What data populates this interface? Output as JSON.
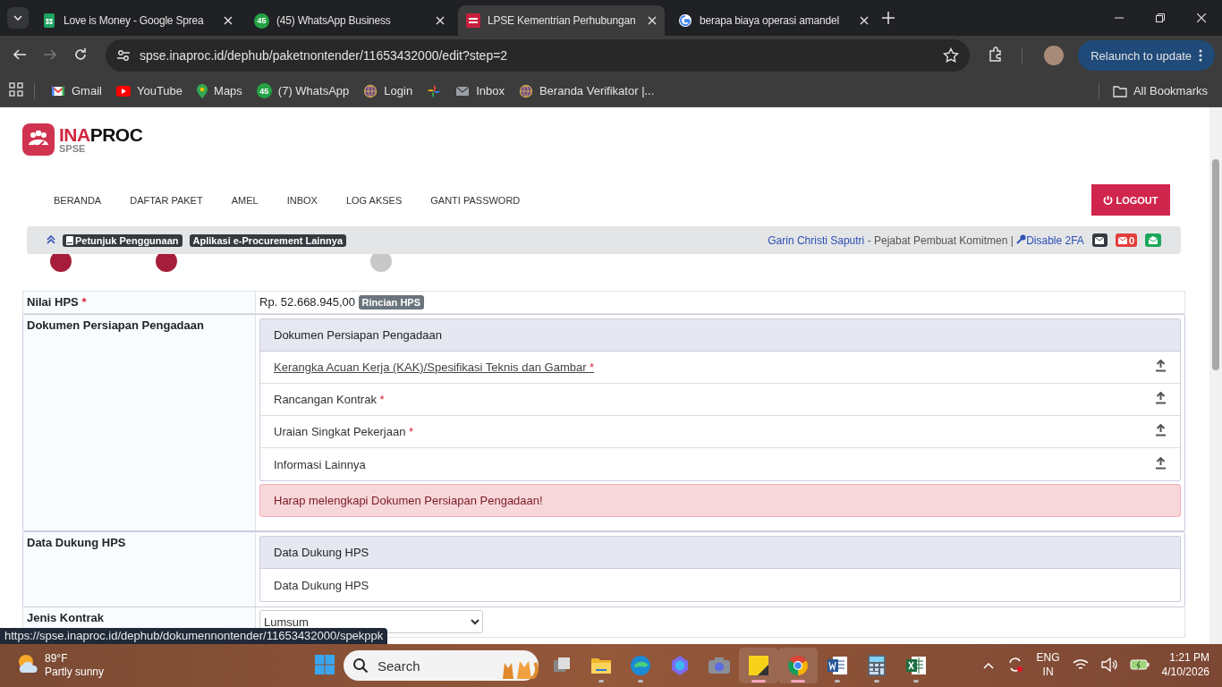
{
  "browser": {
    "tabs": [
      {
        "kind": "sheets",
        "title": "Love is Money - Google Sprea",
        "selected": false
      },
      {
        "kind": "whatsapp",
        "badge": "45",
        "title": "(45) WhatsApp Business",
        "selected": false
      },
      {
        "kind": "inaproc",
        "title": "LPSE Kementrian Perhubungan",
        "selected": true
      },
      {
        "kind": "google",
        "title": "berapa biaya operasi amandel",
        "selected": false
      }
    ],
    "address": "spse.inaproc.id/dephub/paketnontender/11653432000/edit?step=2",
    "relaunch": "Relaunch to update",
    "bookmarks": [
      {
        "kind": "gmail",
        "label": "Gmail"
      },
      {
        "kind": "youtube",
        "label": "YouTube"
      },
      {
        "kind": "maps",
        "label": "Maps"
      },
      {
        "kind": "whatsapp",
        "badge": "45",
        "label": "(7) WhatsApp"
      },
      {
        "kind": "globe",
        "label": "Login"
      },
      {
        "kind": "photos"
      },
      {
        "kind": "mail",
        "label": "Inbox"
      },
      {
        "kind": "globe",
        "label": "Beranda Verifikator |..."
      }
    ],
    "all_bookmarks": "All Bookmarks"
  },
  "site": {
    "logo": {
      "brand_red": "INA",
      "brand_dark": "PROC",
      "sub": "SPSE"
    },
    "nav": [
      "BERANDA",
      "DAFTAR PAKET",
      "AMEL",
      "INBOX",
      "LOG AKSES",
      "GANTI PASSWORD"
    ],
    "logout": "LOGOUT",
    "info_bar": {
      "links": [
        "Petunjuk Penggunaan",
        "Aplikasi e-Procurement Lainnya"
      ],
      "user": "Garin Christi Saputri",
      "role": " - Pejabat Pembuat Komitmen | ",
      "disable_2fa": "Disable 2FA",
      "mail_count": "0"
    },
    "steps": [
      {
        "done": true
      },
      {
        "done": true
      },
      {
        "done": false
      }
    ]
  },
  "form": {
    "rows": [
      {
        "kind": "amount",
        "label": "Nilai HPS",
        "required_mark": "*",
        "value": "Rp. 52.668.945,00",
        "button": "Rincian HPS"
      },
      {
        "kind": "panel",
        "label": "Dokumen Persiapan Pengadaan",
        "panel": {
          "title": "Dokumen Persiapan Pengadaan",
          "items": [
            {
              "label": "Kerangka Acuan Kerja (KAK)/Spesifikasi Teknis dan Gambar",
              "required_mark": "*",
              "hovered": true,
              "upload": true
            },
            {
              "label": "Rancangan Kontrak",
              "required_mark": "*",
              "hovered": false,
              "upload": true
            },
            {
              "label": "Uraian Singkat Pekerjaan",
              "required_mark": "*",
              "hovered": false,
              "upload": true
            },
            {
              "label": "Informasi Lainnya",
              "hovered": false,
              "upload": true
            }
          ],
          "alert": "Harap melengkapi Dokumen Persiapan Pengadaan!"
        }
      },
      {
        "kind": "panel",
        "label": "Data Dukung HPS",
        "panel": {
          "title": "Data Dukung HPS",
          "items": [
            {
              "label": "Data Dukung HPS",
              "hovered": false,
              "upload": false
            }
          ]
        }
      },
      {
        "kind": "select",
        "label": "Jenis Kontrak",
        "value": "Lumsum"
      }
    ]
  },
  "status_url": "https://spse.inaproc.id/dephub/dokumennontender/11653432000/spekppk",
  "taskbar": {
    "weather": {
      "temp": "89°F",
      "condition": "Partly sunny"
    },
    "search": "Search",
    "apps": [
      {
        "kind": "taskview",
        "running": false,
        "selected": false
      },
      {
        "kind": "explorer",
        "running": true,
        "selected": false
      },
      {
        "kind": "edge",
        "running": true,
        "selected": false
      },
      {
        "kind": "copilot",
        "running": false,
        "selected": false
      },
      {
        "kind": "camera",
        "running": false,
        "selected": false
      },
      {
        "kind": "sticky",
        "running": true,
        "selected": true
      },
      {
        "kind": "chrome",
        "running": true,
        "selected": true
      },
      {
        "kind": "word",
        "running": true,
        "selected": false
      },
      {
        "kind": "calculator",
        "running": true,
        "selected": false
      },
      {
        "kind": "excel",
        "running": true,
        "selected": false
      }
    ],
    "tray": {
      "lang": "ENG",
      "region": "IN",
      "time": "1:21 PM",
      "date": "4/10/2026"
    }
  }
}
